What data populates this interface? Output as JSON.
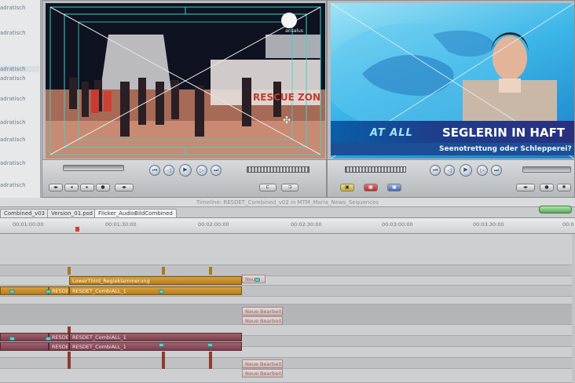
{
  "browser": {
    "items": [
      "adratisch",
      "adratisch",
      "adratisch",
      "adratisch",
      "adratisch",
      "adratisch",
      "adratisch",
      "adratisch",
      "adratisch"
    ]
  },
  "viewer_left": {
    "logo_text": "ansalus",
    "sign_text": "RESCUE ZON"
  },
  "viewer_right": {
    "brand": "AT ALL",
    "headline": "SEGLERIN IN HAFT",
    "subline": "Seenotrettung oder Schlepperei?"
  },
  "timeline": {
    "title": "Timeline: RESDET_Combined_v02 in MTM_Maria_News_Sequences",
    "tabs": [
      "Combined_v03",
      "Version_01.psd",
      "Flicker_AudioBildCombined"
    ],
    "ruler_ticks": [
      "00:01:00:00",
      "00:01:30:00",
      "00:02:00:00",
      "00:02:30:00",
      "00:03:00:00",
      "00:03:30:00",
      "00:0"
    ],
    "clips": {
      "lower_third": "LowerThird_Regieklammerung",
      "combi_v": "RESDET_CombiALL_1",
      "resdet": "RESDE",
      "resdet2": "RESDET",
      "combi_a1": "RESDET_CombiALL_1",
      "combi_a2": "RESDET_CombiALL_1",
      "neue_bearb": "Neue Bearbeit",
      "neue_bearb2": "Neue Bearbeit",
      "neue_bearb3": "Neue Bearbeit",
      "neue_bearb4": "Neue Bearbeit",
      "small": "Neue"
    }
  },
  "colors": {
    "accent_gold": "#c88f2a",
    "accent_mauve": "#8c4d5b",
    "news_blue": "#1d3f8c",
    "guide_teal": "#35d6c8"
  }
}
